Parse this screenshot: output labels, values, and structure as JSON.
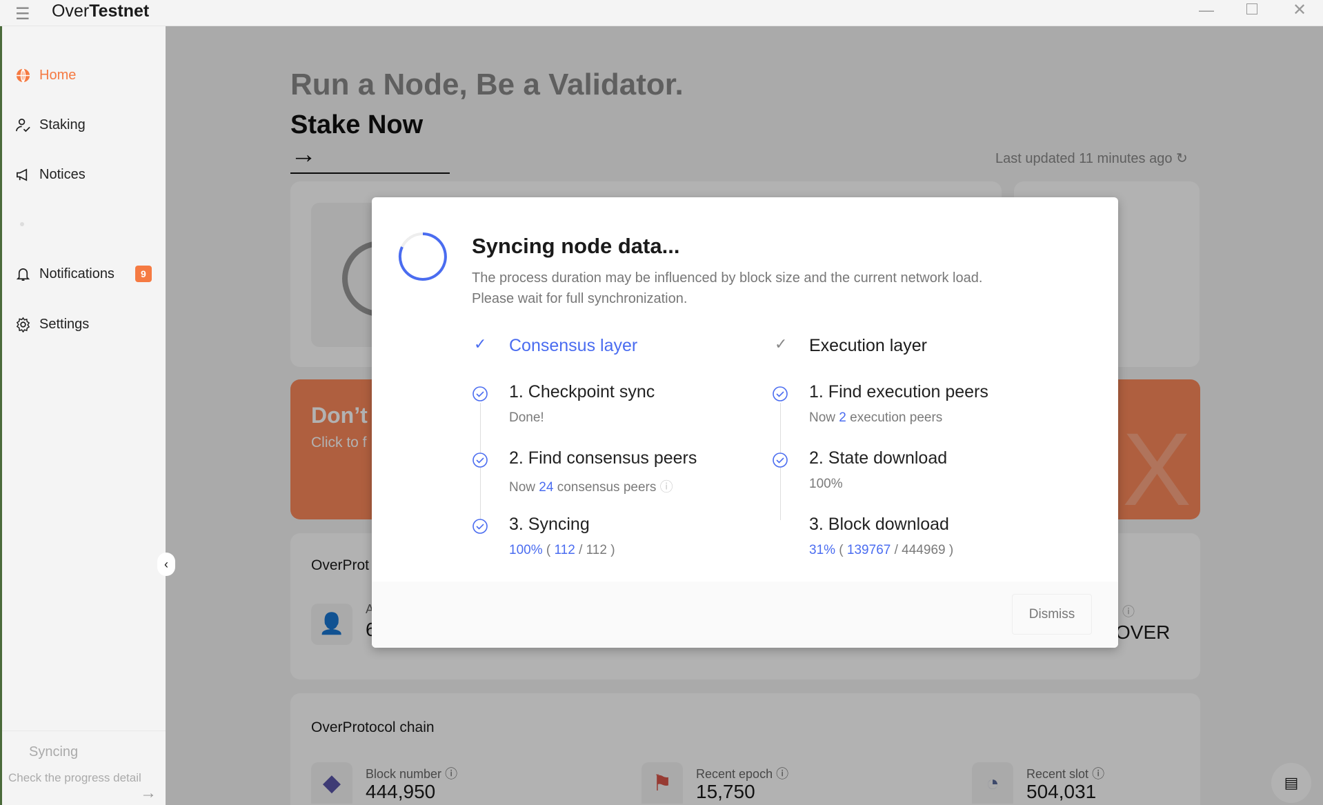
{
  "app": {
    "title_light": "Over",
    "title_bold": "Testnet"
  },
  "sidebar": {
    "items": [
      {
        "label": "Home",
        "icon": "globe-icon",
        "active": true
      },
      {
        "label": "Staking",
        "icon": "user-check-icon"
      },
      {
        "label": "Notices",
        "icon": "megaphone-icon"
      },
      {
        "label": "Notifications",
        "icon": "bell-icon",
        "badge": "9"
      },
      {
        "label": "Settings",
        "icon": "gear-icon"
      }
    ],
    "status": {
      "title": "Syncing",
      "detail": "Check the progress detail"
    }
  },
  "main": {
    "headline": "Run a Node, Be a Validator.",
    "cta": "Stake Now",
    "last_updated": "Last updated 11 minutes ago",
    "banner": {
      "title": "Don’t",
      "subtitle": "Click to f"
    },
    "card3": {
      "title": "OverProt",
      "label_partial": "A",
      "value_partial": "6",
      "unit": "OVER"
    },
    "chain": {
      "title": "OverProtocol chain",
      "stats": [
        {
          "label": "Block number",
          "value": "444,950"
        },
        {
          "label": "Recent epoch",
          "value": "15,750"
        },
        {
          "label": "Recent slot",
          "value": "504,031"
        }
      ]
    }
  },
  "modal": {
    "title": "Syncing node data...",
    "desc1": "The process duration may be influenced by block size and the current network load.",
    "desc2": "Please wait for full synchronization.",
    "consensus": {
      "title": "Consensus layer",
      "steps": [
        {
          "title": "1. Checkpoint sync",
          "sub": "Done!"
        },
        {
          "title": "2. Find consensus peers",
          "pre": "Now ",
          "num": "24",
          "post": " consensus peers"
        },
        {
          "title": "3. Syncing",
          "pct": "100%",
          "cur": "112",
          "total": "112"
        }
      ]
    },
    "execution": {
      "title": "Execution layer",
      "steps": [
        {
          "title": "1. Find execution peers",
          "pre": "Now ",
          "num": "2",
          "post": " execution peers"
        },
        {
          "title": "2. State download",
          "pct": "100%"
        },
        {
          "title": "3. Block download",
          "pct": "31%",
          "cur": "139767",
          "total": "444969"
        }
      ]
    },
    "dismiss": "Dismiss"
  },
  "colors": {
    "accent": "#f57a42",
    "blue": "#4a6cf0"
  }
}
